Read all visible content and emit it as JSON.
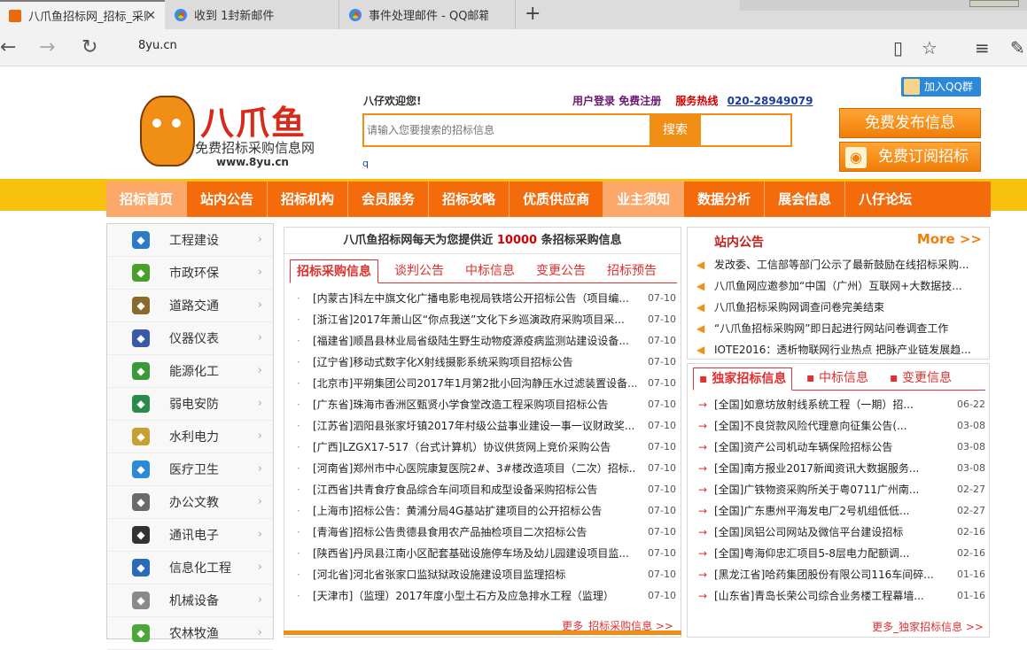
{
  "browser": {
    "tabs": [
      {
        "title": "八爪鱼招标网_招标_采购",
        "active": true
      },
      {
        "title": "收到 1封新邮件"
      },
      {
        "title": "事件处理邮件 - QQ邮箱"
      }
    ],
    "url": "8yu.cn"
  },
  "header": {
    "brand": "八爪鱼",
    "slogan": "免费招标采购信息网",
    "www": "www.8yu.cn",
    "welcome": "八仔欢迎您!",
    "login": "用户登录",
    "register": "免费注册",
    "hotline_label": "服务热线",
    "hotline": "020-28949079",
    "search_placeholder": "请输入您要搜索的招标信息",
    "search_button": "搜索",
    "small_link": "q",
    "qq_group": "加入QQ群",
    "publish_btn": "免费发布信息",
    "subscribe_btn": "免费订阅招标"
  },
  "menu": [
    "招标首页",
    "站内公告",
    "招标机构",
    "会员服务",
    "招标攻略",
    "优质供应商",
    "业主须知",
    "数据分析",
    "展会信息",
    "八仔论坛"
  ],
  "categories": [
    {
      "label": "工程建设",
      "color": "#2a7cc7"
    },
    {
      "label": "市政环保",
      "color": "#4a9e2a"
    },
    {
      "label": "道路交通",
      "color": "#8a6a2a"
    },
    {
      "label": "仪器仪表",
      "color": "#3a5aa8"
    },
    {
      "label": "能源化工",
      "color": "#3a9a3a"
    },
    {
      "label": "弱电安防",
      "color": "#2a8a4a"
    },
    {
      "label": "水利电力",
      "color": "#c8a030"
    },
    {
      "label": "医疗卫生",
      "color": "#2a8ad8"
    },
    {
      "label": "办公文教",
      "color": "#6a6a6a"
    },
    {
      "label": "通讯电子",
      "color": "#333333"
    },
    {
      "label": "信息化工程",
      "color": "#2a6ab8"
    },
    {
      "label": "机械设备",
      "color": "#8a8a8a"
    },
    {
      "label": "农林牧渔",
      "color": "#4aa83a"
    }
  ],
  "center": {
    "banner_pre": "八爪鱼招标网每天为您提供近",
    "banner_num": "10000",
    "banner_post": "条招标采购信息",
    "tabs": [
      "招标采购信息",
      "谈判公告",
      "中标信息",
      "变更公告",
      "招标预告"
    ],
    "rows": [
      {
        "t": "[内蒙古]科左中旗文化广播电影电视局铁塔公开招标公告（项目编...",
        "d": "07-10"
      },
      {
        "t": "[浙江省]2017年萧山区“你点我送”文化下乡巡演政府采购项目采...",
        "d": "07-10"
      },
      {
        "t": "[福建省]顺昌县林业局省级陆生野生动物疫源疫病监测站建设设备...",
        "d": "07-10"
      },
      {
        "t": "[辽宁省]移动式数字化X射线摄影系统采购项目招标公告",
        "d": "07-10"
      },
      {
        "t": "[北京市]平朔集团公司2017年1月第2批小回沟静压水过滤装置设备...",
        "d": "07-10"
      },
      {
        "t": "[广东省]珠海市香洲区甄贤小学食堂改造工程采购项目招标公告",
        "d": "07-10"
      },
      {
        "t": "[江苏省]泗阳县张家圩镇2017年村级公益事业建设一事一议财政奖...",
        "d": "07-10"
      },
      {
        "t": "[广西]LZGX17-517（台式计算机）协议供货网上竞价采购公告",
        "d": "07-10"
      },
      {
        "t": "[河南省]郑州市中心医院康复医院2#、3#楼改造项目（二次）招标...",
        "d": "07-10"
      },
      {
        "t": "[江西省]共青食疗食品综合车间项目和成型设备采购招标公告",
        "d": "07-10"
      },
      {
        "t": "[上海市]招标公告：黄浦分局4G基站扩建项目的公开招标公告",
        "d": "07-10"
      },
      {
        "t": "[青海省]招标公告贵德县食用农产品抽检项目二次招标公告",
        "d": "07-10"
      },
      {
        "t": "[陕西省]丹凤县江南小区配套基础设施停车场及幼儿园建设项目监...",
        "d": "07-10"
      },
      {
        "t": "[河北省]河北省张家口监狱狱政设施建设项目监理招标",
        "d": "07-10"
      },
      {
        "t": "[天津市]（监理）2017年度小型土石方及应急排水工程（监理）",
        "d": "07-10"
      }
    ],
    "more": "更多_招标采购信息 >>"
  },
  "notices": {
    "title": "站内公告",
    "more": "More >>",
    "items": [
      "发改委、工信部等部门公示了最新鼓励在线招标采购...",
      "八爪鱼网应邀参加“中国（广州）互联网+大数据技...",
      "八爪鱼招标采购网调查问卷完美结束",
      "“八爪鱼招标采购网”即日起进行网站问卷调查工作",
      "IOTE2016：透析物联网行业热点 把脉产业链发展趋..."
    ]
  },
  "exclusive": {
    "tabs": [
      "独家招标信息",
      "中标信息",
      "变更信息"
    ],
    "rows": [
      {
        "t": "[全国]如意坊放射线系统工程（一期）招...",
        "d": "06-22"
      },
      {
        "t": "[全国]不良贷款风险代理意向征集公告(...",
        "d": "03-08"
      },
      {
        "t": "[全国]资产公司机动车辆保险招标公告",
        "d": "03-08"
      },
      {
        "t": "[全国]南方报业2017新闻资讯大数据服务...",
        "d": "03-08"
      },
      {
        "t": "[全国]广铁物资采购所关于粤0711广州南...",
        "d": "02-27"
      },
      {
        "t": "[全国]广东惠州平海发电厂2号机组低低...",
        "d": "02-27"
      },
      {
        "t": "[全国]凤铝公司网站及微信平台建设招标",
        "d": "02-16"
      },
      {
        "t": "[全国]粤海仰忠汇项目5-8层电力配额调...",
        "d": "02-16"
      },
      {
        "t": "[黑龙江省]哈药集团股份有限公司116车间碎...",
        "d": "01-16"
      },
      {
        "t": "[山东省]青岛长荣公司综合业务楼工程幕墙...",
        "d": "01-16"
      }
    ],
    "more": "更多_独家招标信息 >>"
  }
}
